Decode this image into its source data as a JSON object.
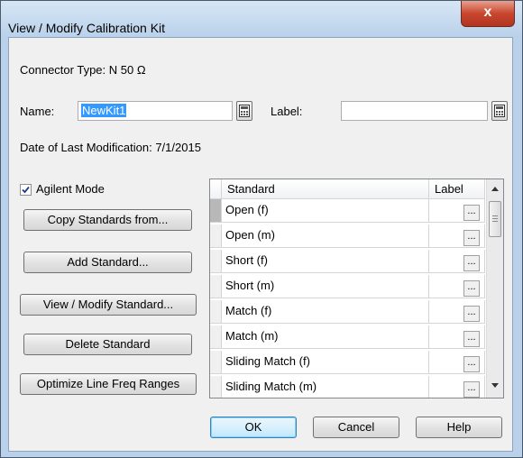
{
  "window": {
    "title": "View / Modify Calibration Kit",
    "close_glyph": "x"
  },
  "connector": {
    "label": "Connector Type:",
    "value": "N 50 Ω"
  },
  "name": {
    "label": "Name:",
    "value": "NewKit1"
  },
  "label_field": {
    "label": "Label:",
    "value": ""
  },
  "date": {
    "label": "Date of Last Modification:",
    "value": "7/1/2015"
  },
  "agilent_mode": {
    "label": "Agilent Mode",
    "checked": true
  },
  "buttons": {
    "copy": "Copy Standards from...",
    "add": "Add Standard...",
    "view_modify": "View / Modify Standard...",
    "delete": "Delete Standard",
    "optimize": "Optimize Line Freq Ranges"
  },
  "table": {
    "columns": [
      "Standard",
      "Label"
    ],
    "rows": [
      {
        "standard": "Open (f)",
        "label": ""
      },
      {
        "standard": "Open (m)",
        "label": ""
      },
      {
        "standard": "Short (f)",
        "label": ""
      },
      {
        "standard": "Short (m)",
        "label": ""
      },
      {
        "standard": "Match (f)",
        "label": ""
      },
      {
        "standard": "Match (m)",
        "label": ""
      },
      {
        "standard": "Sliding Match (f)",
        "label": ""
      },
      {
        "standard": "Sliding Match (m)",
        "label": ""
      }
    ],
    "ellipsis": "..."
  },
  "dialog_buttons": {
    "ok": "OK",
    "cancel": "Cancel",
    "help": "Help"
  },
  "icons": {
    "browse": "keyboard-icon"
  }
}
